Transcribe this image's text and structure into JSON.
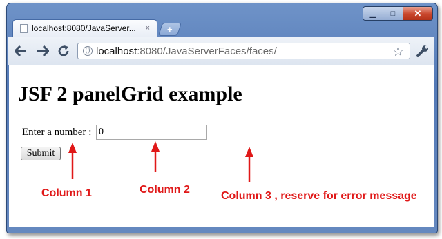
{
  "browser": {
    "tab_title": "localhost:8080/JavaServer...",
    "tab_close": "×",
    "new_tab": "+",
    "url_host": "localhost",
    "url_rest": ":8080/JavaServerFaces/faces/",
    "window_controls": {
      "minimize": "▁",
      "maximize": "□",
      "close": "✕"
    },
    "icons": [
      "back-icon",
      "forward-icon",
      "reload-icon",
      "page-icon",
      "star-icon",
      "wrench-icon"
    ]
  },
  "page": {
    "heading": "JSF 2 panelGrid example",
    "label": "Enter a number :",
    "input_value": "0",
    "submit_label": "Submit"
  },
  "annotations": {
    "col1": "Column 1",
    "col2": "Column 2",
    "col3": "Column 3 , reserve for error message",
    "color": "#e01818"
  }
}
